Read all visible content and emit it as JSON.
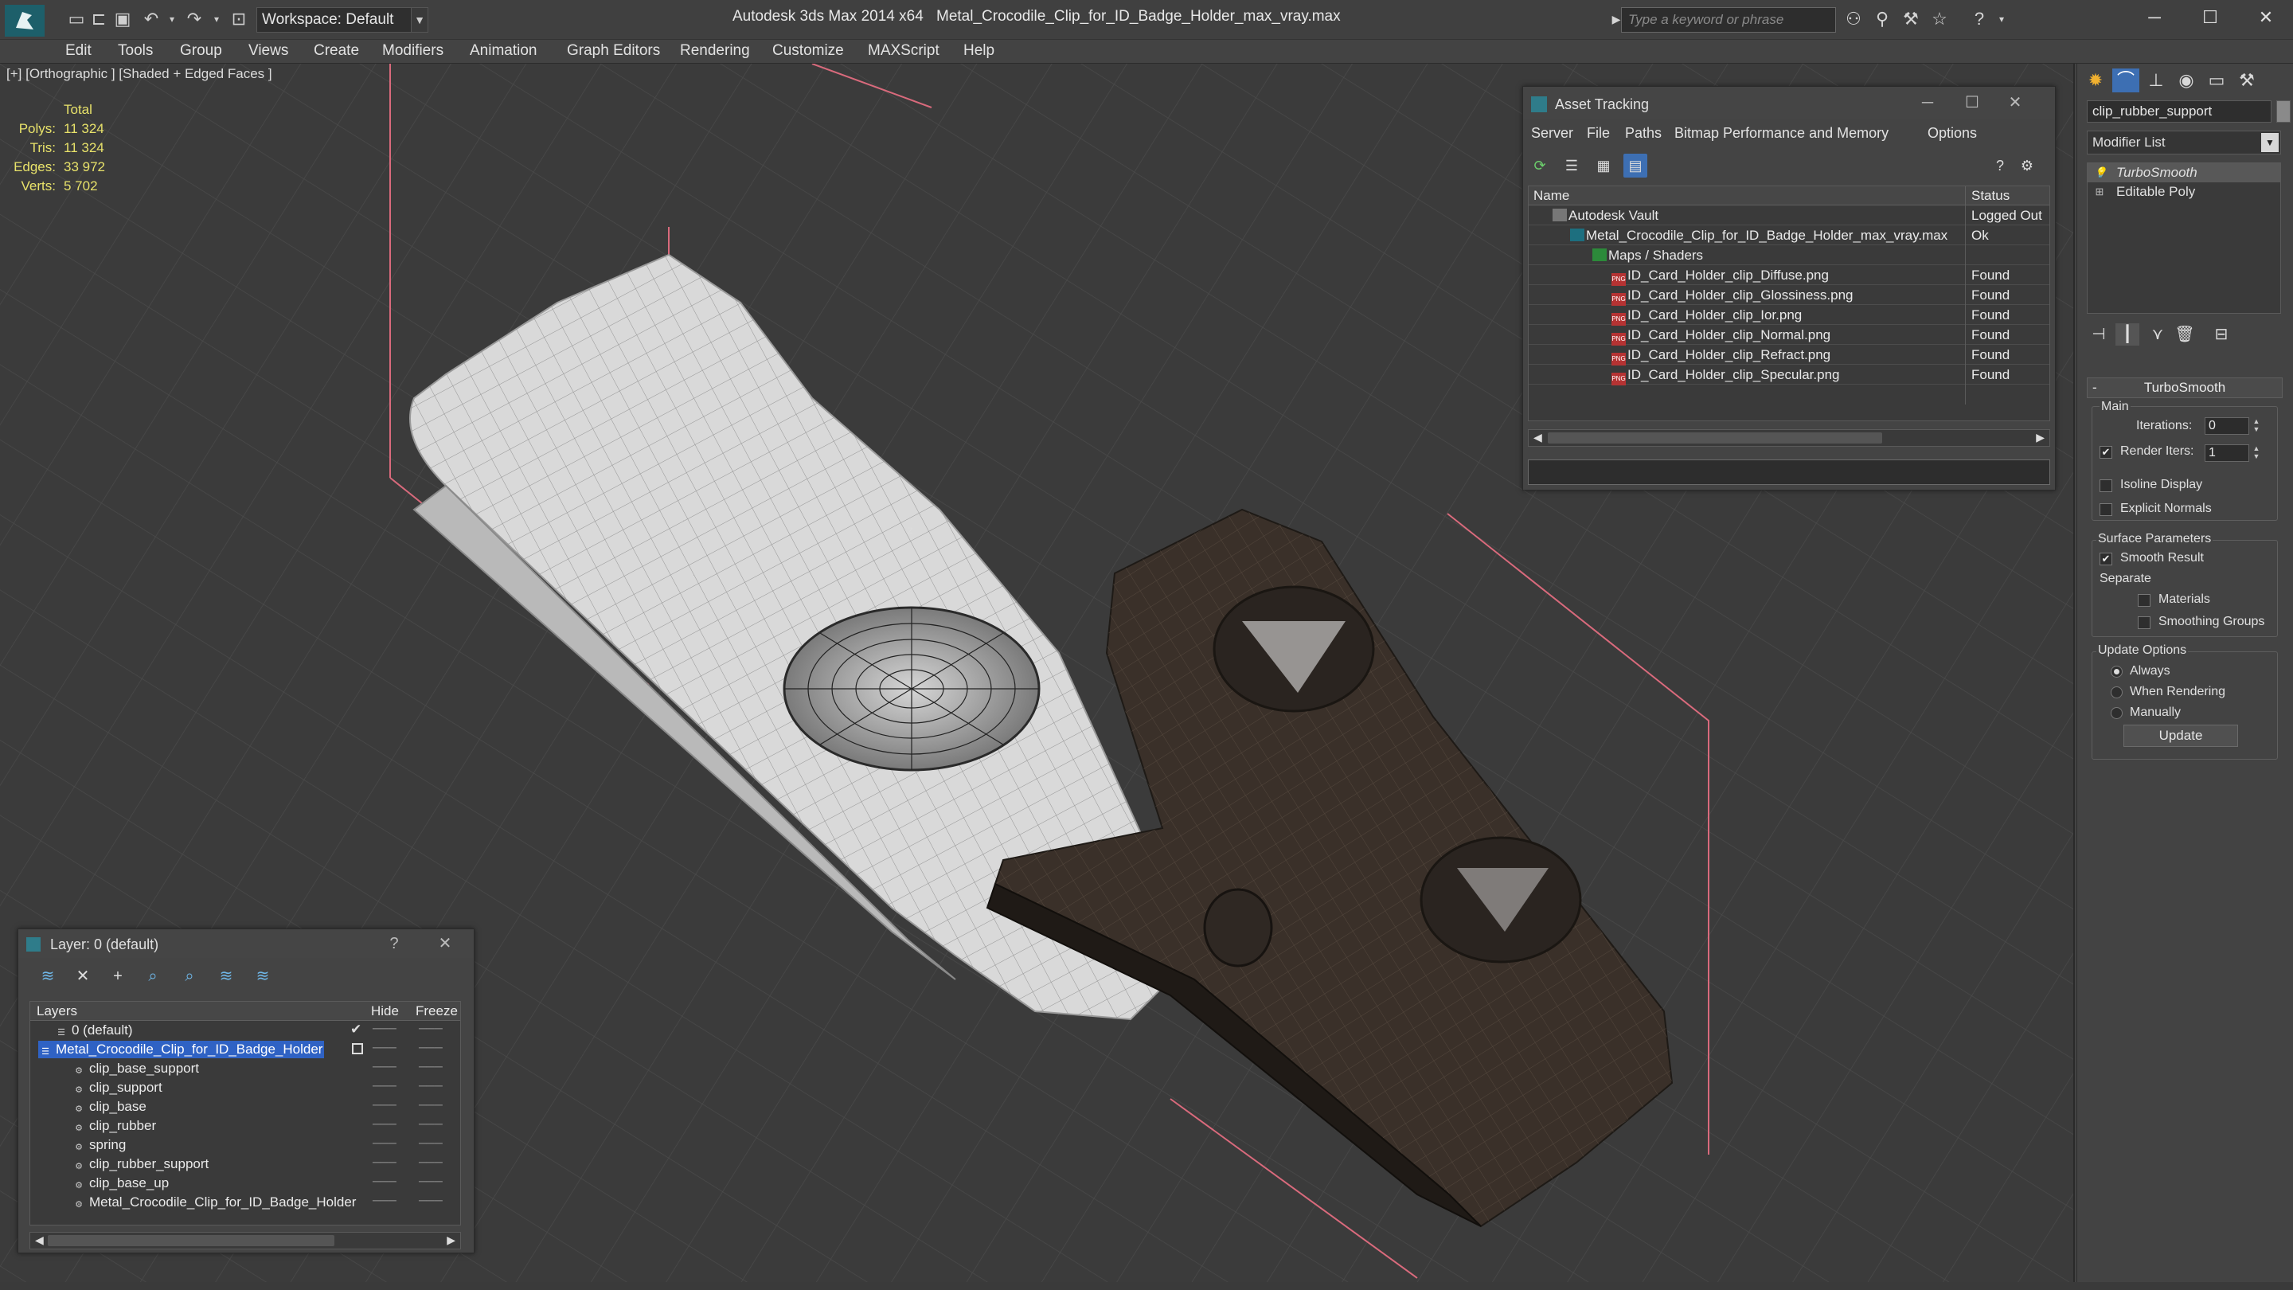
{
  "title_bar": {
    "app_title": "Autodesk 3ds Max  2014 x64",
    "file_title": "Metal_Crocodile_Clip_for_ID_Badge_Holder_max_vray.max",
    "workspace": "Workspace: Default",
    "search_placeholder": "Type a keyword or phrase"
  },
  "menu": [
    "Edit",
    "Tools",
    "Group",
    "Views",
    "Create",
    "Modifiers",
    "Animation",
    "Graph Editors",
    "Rendering",
    "Customize",
    "MAXScript",
    "Help"
  ],
  "viewport": {
    "label": "[+] [Orthographic ] [Shaded + Edged Faces ]",
    "stats": {
      "header": "Total",
      "rows": [
        {
          "k": "Polys:",
          "v": "11 324"
        },
        {
          "k": "Tris:",
          "v": "11 324"
        },
        {
          "k": "Edges:",
          "v": "33 972"
        },
        {
          "k": "Verts:",
          "v": "5 702"
        }
      ]
    }
  },
  "asset_tracking": {
    "title": "Asset Tracking",
    "menu": [
      "Server",
      "File",
      "Paths",
      "Bitmap Performance and Memory",
      "Options"
    ],
    "col_name": "Name",
    "col_status": "Status",
    "rows": [
      {
        "name": "Autodesk Vault",
        "status": "Logged Out",
        "icon": "vault-icon"
      },
      {
        "name": "Metal_Crocodile_Clip_for_ID_Badge_Holder_max_vray.max",
        "status": "Ok",
        "icon": "max-file-icon"
      },
      {
        "name": "Maps / Shaders",
        "status": "",
        "icon": "maps-icon"
      },
      {
        "name": "ID_Card_Holder_clip_Diffuse.png",
        "status": "Found",
        "icon": "png-icon"
      },
      {
        "name": "ID_Card_Holder_clip_Glossiness.png",
        "status": "Found",
        "icon": "png-icon"
      },
      {
        "name": "ID_Card_Holder_clip_Ior.png",
        "status": "Found",
        "icon": "png-icon"
      },
      {
        "name": "ID_Card_Holder_clip_Normal.png",
        "status": "Found",
        "icon": "png-icon"
      },
      {
        "name": "ID_Card_Holder_clip_Refract.png",
        "status": "Found",
        "icon": "png-icon"
      },
      {
        "name": "ID_Card_Holder_clip_Specular.png",
        "status": "Found",
        "icon": "png-icon"
      }
    ]
  },
  "layer_manager": {
    "title": "Layer: 0 (default)",
    "col_layers": "Layers",
    "col_hide": "Hide",
    "col_freeze": "Freeze",
    "rows": [
      {
        "name": "0 (default)",
        "selected": false
      },
      {
        "name": "Metal_Crocodile_Clip_for_ID_Badge_Holder",
        "selected": true
      },
      {
        "name": "clip_base_support",
        "selected": false
      },
      {
        "name": "clip_support",
        "selected": false
      },
      {
        "name": "clip_base",
        "selected": false
      },
      {
        "name": "clip_rubber",
        "selected": false
      },
      {
        "name": "spring",
        "selected": false
      },
      {
        "name": "clip_rubber_support",
        "selected": false
      },
      {
        "name": "clip_base_up",
        "selected": false
      },
      {
        "name": "Metal_Crocodile_Clip_for_ID_Badge_Holder",
        "selected": false
      }
    ]
  },
  "command_panel": {
    "object_name": "clip_rubber_support",
    "modifier_list": "Modifier List",
    "stack": [
      "TurboSmooth",
      "Editable Poly"
    ],
    "rollout_title": "TurboSmooth",
    "main_label": "Main",
    "iterations_label": "Iterations:",
    "iterations_value": "0",
    "render_iters_label": "Render Iters:",
    "render_iters_value": "1",
    "isoline_label": "Isoline Display",
    "explicit_normals_label": "Explicit Normals",
    "surface_params_label": "Surface Parameters",
    "smooth_result_label": "Smooth Result",
    "separate_label": "Separate",
    "materials_label": "Materials",
    "smoothing_groups_label": "Smoothing Groups",
    "update_options_label": "Update Options",
    "always_label": "Always",
    "when_rendering_label": "When Rendering",
    "manually_label": "Manually",
    "update_button": "Update"
  }
}
